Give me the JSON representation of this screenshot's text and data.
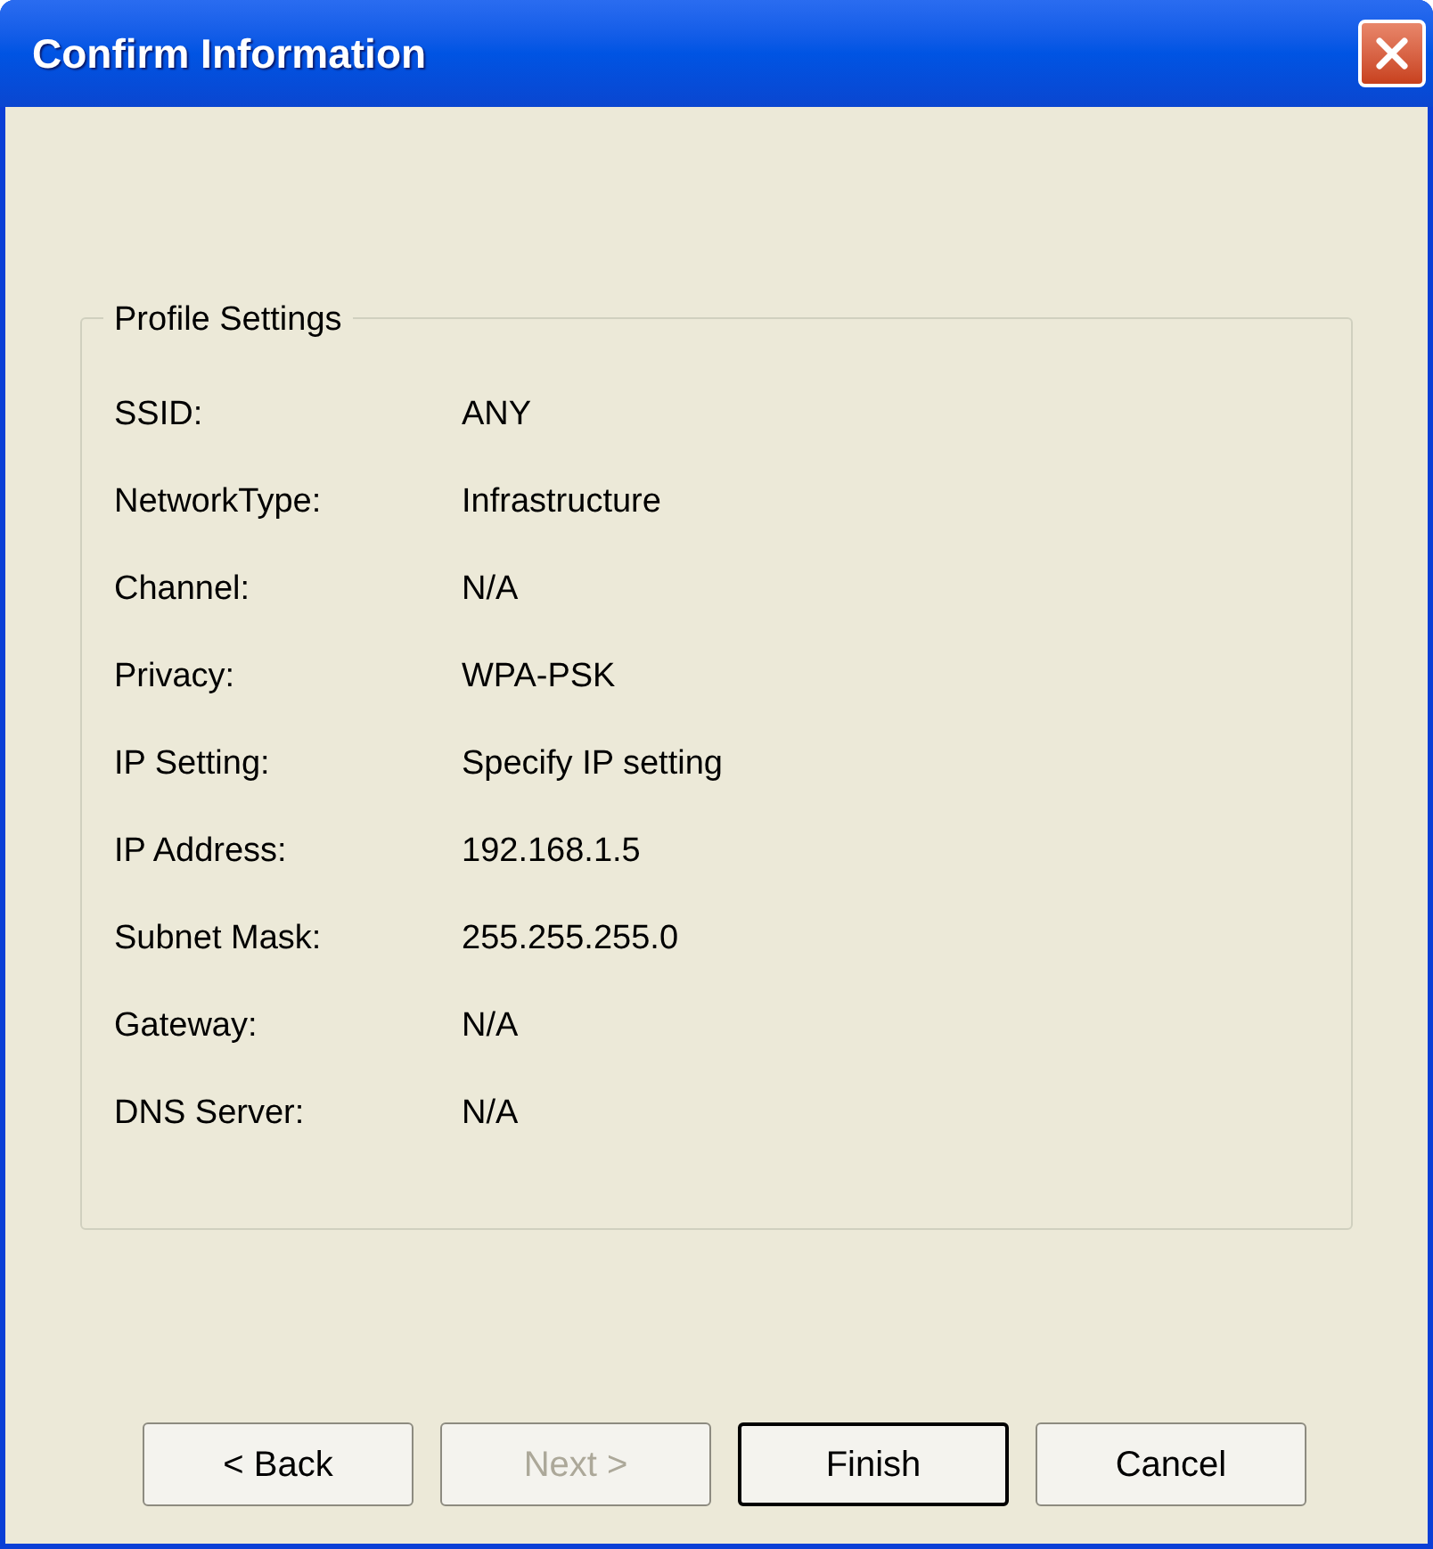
{
  "window": {
    "title": "Confirm Information"
  },
  "group": {
    "title": "Profile Settings",
    "rows": [
      {
        "label": "SSID:",
        "value": "ANY"
      },
      {
        "label": "NetworkType:",
        "value": "Infrastructure"
      },
      {
        "label": "Channel:",
        "value": "N/A"
      },
      {
        "label": "Privacy:",
        "value": "WPA-PSK"
      },
      {
        "label": "IP Setting:",
        "value": "Specify IP setting"
      },
      {
        "label": "IP Address:",
        "value": "192.168.1.5"
      },
      {
        "label": "Subnet Mask:",
        "value": "255.255.255.0"
      },
      {
        "label": "Gateway:",
        "value": "N/A"
      },
      {
        "label": "DNS Server:",
        "value": "N/A"
      }
    ]
  },
  "buttons": [
    {
      "label": "< Back",
      "disabled": false,
      "default": false
    },
    {
      "label": "Next >",
      "disabled": true,
      "default": false
    },
    {
      "label": "Finish",
      "disabled": false,
      "default": true
    },
    {
      "label": "Cancel",
      "disabled": false,
      "default": false
    }
  ]
}
